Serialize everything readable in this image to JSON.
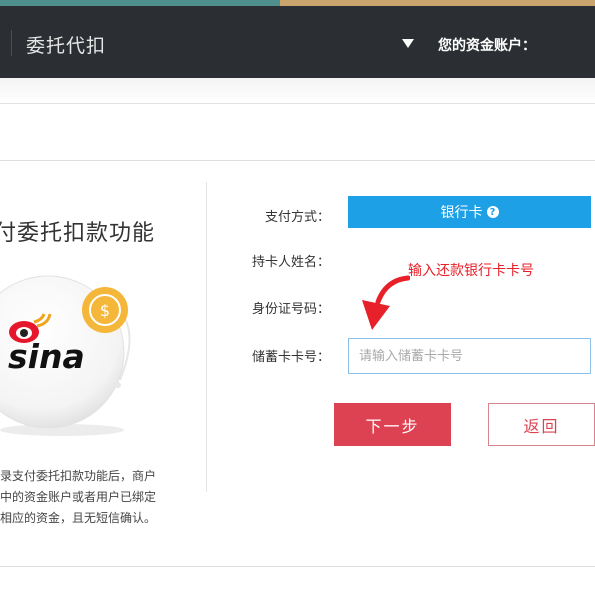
{
  "header": {
    "title": "委托代扣",
    "account_label": "您的资金账户："
  },
  "left_panel": {
    "feature_title": "付委托扣款功能",
    "logo_text": "sina",
    "coin_symbol": "$",
    "description_lines": [
      "录支付委托扣款功能后，商户",
      "中的资金账户或者用户已绑定",
      "相应的资金，且无短信确认。"
    ]
  },
  "form": {
    "payment_method_label": "支付方式：",
    "payment_method_value": "银行卡",
    "cardholder_label": "持卡人姓名：",
    "id_number_label": "身份证号码：",
    "card_number_label": "储蓄卡卡号：",
    "card_number_placeholder": "请输入储蓄卡卡号",
    "annotation_text": "输入还款银行卡卡号",
    "next_button": "下一步",
    "back_button": "返回"
  },
  "colors": {
    "header_bg": "#2b2f33",
    "accent_blue": "#1ea0e6",
    "next_red": "#dc4252",
    "annotation_red": "#e8202a",
    "coin_gold": "#f4b73a"
  }
}
